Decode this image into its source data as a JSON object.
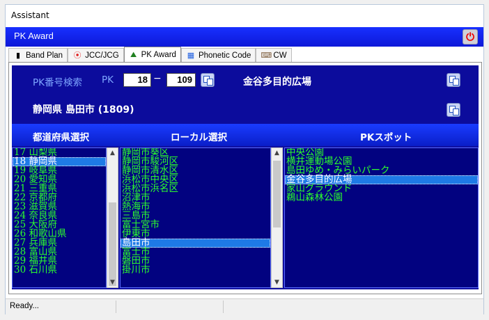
{
  "window": {
    "title": "Assistant"
  },
  "header": {
    "title": "PK Award",
    "power_icon": "power-icon",
    "accent": "#1a2cf0"
  },
  "tabs": [
    {
      "label": "Band Plan",
      "icon": "band-plan-icon"
    },
    {
      "label": "JCC/JCG",
      "icon": "location-pin-icon"
    },
    {
      "label": "PK Award",
      "icon": "pk-award-icon",
      "active": true
    },
    {
      "label": "Phonetic Code",
      "icon": "phonetic-code-icon"
    },
    {
      "label": "CW",
      "icon": "cw-icon"
    }
  ],
  "pk_search": {
    "label": "PK番号検索",
    "prefix": "PK",
    "number1": "18",
    "separator": "−",
    "number2": "109",
    "spot_name": "金谷多目的広場",
    "location": "静岡県 島田市 (1809)"
  },
  "columns": {
    "prefecture": "都道府県選択",
    "local": "ローカル選択",
    "spot": "PKスポット"
  },
  "prefectures": [
    "17 山梨県",
    "18 静岡県",
    "19 岐阜県",
    "20 愛知県",
    "21 三重県",
    "22 京都府",
    "23 滋賀県",
    "24 奈良県",
    "25 大阪府",
    "26 和歌山県",
    "27 兵庫県",
    "28 富山県",
    "29 福井県",
    "30 石川県"
  ],
  "prefecture_selected": 1,
  "locals": [
    "静岡市葵区",
    "静岡市駿河区",
    "静岡市清水区",
    "浜松市中央区",
    "浜松市浜名区",
    "沼津市",
    "熱海市",
    "三島市",
    "富士宮市",
    "伊東市",
    "島田市",
    "富士市",
    "磐田市",
    "掛川市"
  ],
  "local_selected": 10,
  "spots": [
    "中央公園",
    "横井運動場公園",
    "島田ゆめ・みらいパーク",
    "金谷多目的広場",
    "家山グラウンド",
    "鵜山森林公園"
  ],
  "spot_selected": 3,
  "status": {
    "text": "Ready..."
  },
  "colors": {
    "list_bg": "#020280",
    "item_text": "#2cff2c",
    "selection": "#1e7ae6"
  }
}
